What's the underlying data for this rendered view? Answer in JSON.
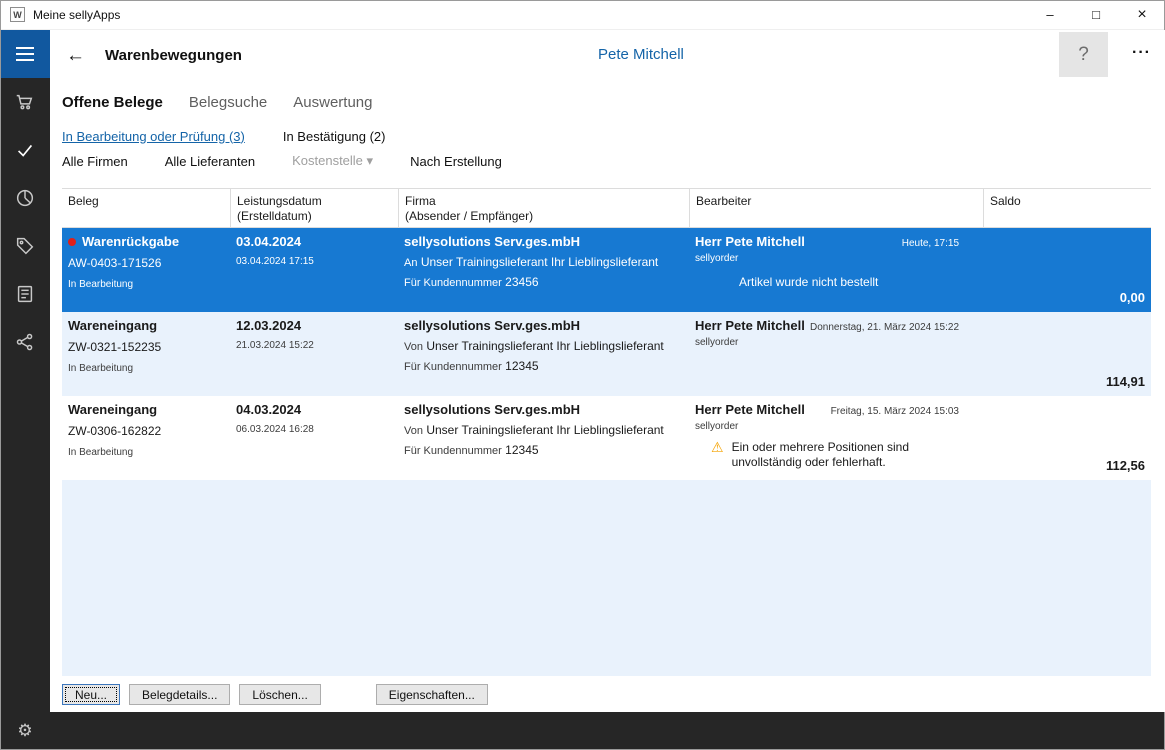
{
  "window": {
    "title": "Meine sellyApps",
    "app_icon_letter": "W",
    "minimize": "–",
    "maximize": "□",
    "close": "×"
  },
  "header": {
    "back": "←",
    "title": "Warenbewegungen",
    "user": "Pete Mitchell",
    "help": "?",
    "more": "···"
  },
  "tabs": [
    {
      "label": "Offene Belege"
    },
    {
      "label": "Belegsuche"
    },
    {
      "label": "Auswertung"
    }
  ],
  "filters": {
    "status": [
      {
        "label": "In Bearbeitung oder Prüfung (3)"
      },
      {
        "label": "In Bestätigung (2)"
      }
    ],
    "selectors": [
      {
        "label": "Alle Firmen"
      },
      {
        "label": "Alle Lieferanten"
      },
      {
        "label": "Kostenstelle",
        "caret": "▾"
      },
      {
        "label": "Nach Erstellung"
      }
    ]
  },
  "table": {
    "columns": [
      {
        "line1": "Beleg",
        "line2": ""
      },
      {
        "line1": "Leistungsdatum",
        "line2": "(Erstelldatum)"
      },
      {
        "line1": "Firma",
        "line2": "(Absender / Empfänger)"
      },
      {
        "line1": "Bearbeiter",
        "line2": ""
      },
      {
        "line1": "Saldo",
        "line2": ""
      }
    ],
    "rows": [
      {
        "type": "Warenrückgabe",
        "doc": "AW-0403-171526",
        "status": "In Bearbeitung",
        "date": "03.04.2024",
        "created": "03.04.2024 17:15",
        "company": "sellysolutions Serv.ges.mbH",
        "dir": "An",
        "partner": "Unser Trainingslieferant Ihr Lieblingslieferant",
        "cust_label": "Für Kundennummer",
        "cust_no": "23456",
        "editor": "Herr Pete Mitchell",
        "editor_app": "sellyorder",
        "timestamp": "Heute, 17:15",
        "note": "Artikel wurde nicht bestellt",
        "saldo": "0,00"
      },
      {
        "type": "Wareneingang",
        "doc": "ZW-0321-152235",
        "status": "In Bearbeitung",
        "date": "12.03.2024",
        "created": "21.03.2024 15:22",
        "company": "sellysolutions Serv.ges.mbH",
        "dir": "Von",
        "partner": "Unser Trainingslieferant Ihr Lieblingslieferant",
        "cust_label": "Für Kundennummer",
        "cust_no": "12345",
        "editor": "Herr Pete Mitchell",
        "editor_app": "sellyorder",
        "timestamp": "Donnerstag, 21. März 2024 15:22",
        "saldo": "114,91"
      },
      {
        "type": "Wareneingang",
        "doc": "ZW-0306-162822",
        "status": "In Bearbeitung",
        "date": "04.03.2024",
        "created": "06.03.2024 16:28",
        "company": "sellysolutions Serv.ges.mbH",
        "dir": "Von",
        "partner": "Unser Trainingslieferant Ihr Lieblingslieferant",
        "cust_label": "Für Kundennummer",
        "cust_no": "12345",
        "editor": "Herr Pete Mitchell",
        "editor_app": "sellyorder",
        "timestamp": "Freitag, 15. März 2024 15:03",
        "warning_icon": "⚠",
        "warning": "Ein oder mehrere Positionen sind unvollständig oder fehlerhaft.",
        "saldo": "112,56"
      }
    ]
  },
  "buttons": [
    {
      "label": "Neu..."
    },
    {
      "label": "Belegdetails..."
    },
    {
      "label": "Löschen..."
    },
    {
      "label": "Eigenschaften..."
    }
  ],
  "sidebar": {
    "icons": [
      "menu-icon",
      "cart-icon",
      "check-icon",
      "pie-chart-icon",
      "tag-icon",
      "ledger-icon",
      "share-icon",
      "gear-icon"
    ],
    "gear": "⚙"
  },
  "colors": {
    "accent_blue": "#11589f",
    "selection_blue": "#1779d2",
    "link_blue": "#1464a8",
    "sidebar_dark": "#262626",
    "row_alt": "#e9f2fc",
    "warning_orange": "#f5a300",
    "red_dot": "#e0201a"
  }
}
